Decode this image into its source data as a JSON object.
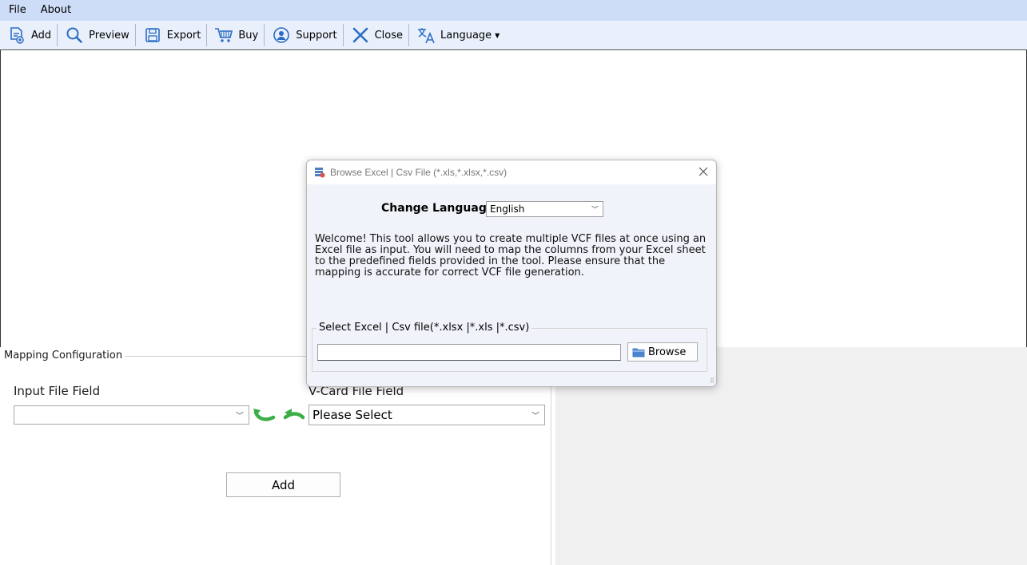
{
  "menu": {
    "items": [
      "File",
      "About"
    ]
  },
  "toolbar": {
    "add": "Add",
    "preview": "Preview",
    "export": "Export",
    "buy": "Buy",
    "support": "Support",
    "close": "Close",
    "language": "Language",
    "icons": [
      "add-file-icon",
      "magnifier-icon",
      "save-icon",
      "cart-icon",
      "headset-icon",
      "close-x-icon",
      "translate-icon",
      "caret-down-icon"
    ]
  },
  "mapping": {
    "title": "Mapping Configuration",
    "input_label": "Input File Field",
    "input_value": "",
    "vcard_label": "V-Card File Field",
    "vcard_value": "Please Select",
    "add_label": "Add"
  },
  "dialog": {
    "title": "Browse Excel | Csv File (*.xls,*.xlsx,*.csv)",
    "lang_label": "Change Language",
    "lang_value": "English",
    "welcome": "Welcome! This tool allows you to create multiple VCF files at once using an Excel file as input. You will need to map the columns from your Excel sheet to the predefined fields provided in the tool. Please ensure that the mapping is accurate for correct VCF file generation.",
    "file_group_label": "Select Excel | Csv file(*.xlsx |*.xls |*.csv)",
    "file_value": "",
    "browse_label": "Browse"
  },
  "colors": {
    "menubar": "#cddcf7",
    "toolbar": "#e9f0fc",
    "icon_blue": "#2a6cc4",
    "arrow_green": "#3cae46"
  }
}
